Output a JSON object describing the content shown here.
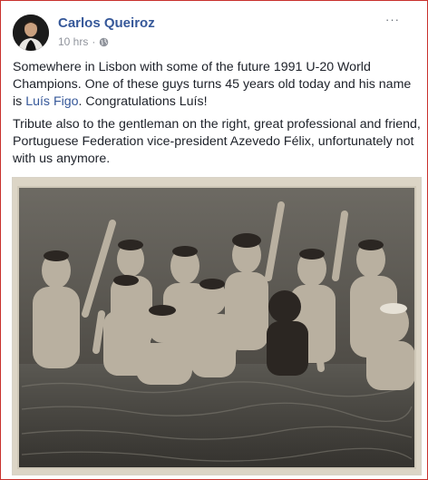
{
  "post": {
    "author": "Carlos Queiroz",
    "time": "10 hrs",
    "more_label": "···",
    "paragraph1_before_link": "Somewhere in Lisbon with some of the future 1991 U-20 World Champions. One of these guys turns 45 years old today and his name is ",
    "link_text": "Luís Figo",
    "paragraph1_after_link": ". Congratulations Luís!",
    "paragraph2": "Tribute also to the gentleman on the right, great professional and friend, Portuguese Federation vice-president Azevedo Félix, unfortunately not with us anymore."
  },
  "icons": {
    "privacy": "globe-icon",
    "options": "more-options-icon"
  },
  "colors": {
    "author_link": "#365899",
    "meta_text": "#90949c",
    "body_text": "#1d2129",
    "frame_border": "#c9312c"
  }
}
